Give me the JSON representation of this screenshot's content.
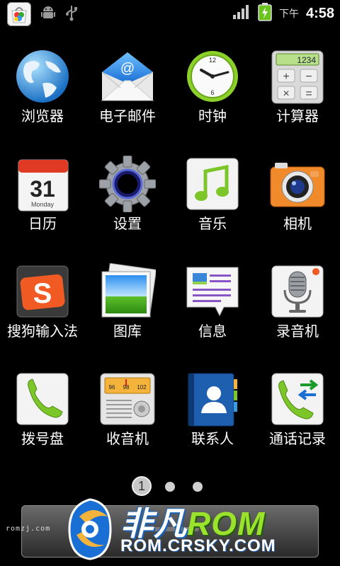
{
  "status_bar": {
    "time_period": "下午",
    "time": "4:58",
    "icons": [
      "app-notification-icon",
      "android-debug-icon",
      "usb-icon",
      "signal-icon",
      "battery-charging-icon"
    ]
  },
  "apps": [
    {
      "label": "浏览器",
      "icon": "globe-icon"
    },
    {
      "label": "电子邮件",
      "icon": "email-icon"
    },
    {
      "label": "时钟",
      "icon": "clock-icon"
    },
    {
      "label": "计算器",
      "icon": "calculator-icon",
      "display": "1234"
    },
    {
      "label": "日历",
      "icon": "calendar-icon",
      "day": "31",
      "weekday": "Monday"
    },
    {
      "label": "设置",
      "icon": "gear-icon"
    },
    {
      "label": "音乐",
      "icon": "music-note-icon"
    },
    {
      "label": "相机",
      "icon": "camera-icon"
    },
    {
      "label": "搜狗输入法",
      "icon": "sogou-s-icon",
      "glyph": "S"
    },
    {
      "label": "图库",
      "icon": "photo-gallery-icon"
    },
    {
      "label": "信息",
      "icon": "message-icon"
    },
    {
      "label": "录音机",
      "icon": "microphone-icon"
    },
    {
      "label": "拨号盘",
      "icon": "phone-handset-icon"
    },
    {
      "label": "收音机",
      "icon": "radio-icon",
      "freqs": [
        "96",
        "98",
        "102"
      ]
    },
    {
      "label": "联系人",
      "icon": "contacts-book-icon"
    },
    {
      "label": "通话记录",
      "icon": "call-log-icon"
    }
  ],
  "pager": {
    "current": "1",
    "total": 3
  },
  "watermark": {
    "small_text": "romzj.com",
    "title_a": "非凡",
    "title_b": "ROM",
    "url": "ROM.CRSKY.COM"
  }
}
